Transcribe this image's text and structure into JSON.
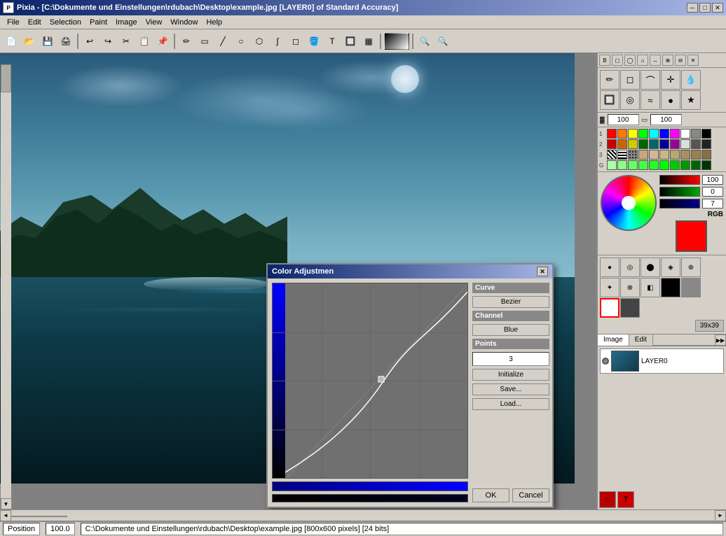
{
  "titlebar": {
    "title": "Pixia - [C:\\Dokumente und Einstellungen\\rdubach\\Desktop\\example.jpg [LAYER0] of Standard Accuracy]",
    "min_btn": "─",
    "max_btn": "□",
    "close_btn": "✕"
  },
  "menu": {
    "items": [
      "File",
      "Edit",
      "Selection",
      "Paint",
      "Image",
      "View",
      "Window",
      "Help"
    ]
  },
  "dialog": {
    "title": "Color Adjustmen",
    "close_btn": "✕",
    "curve_label": "Curve",
    "bezier_btn": "Bezier",
    "channel_label": "Channel",
    "blue_btn": "Blue",
    "points_label": "Points",
    "points_value": "3",
    "initialize_btn": "Initialize",
    "save_btn": "Save...",
    "load_btn": "Load...",
    "ok_btn": "OK",
    "cancel_btn": "Cancel"
  },
  "right_panel": {
    "opacity_value": "100",
    "size_value": "100",
    "rgb_label": "RGB",
    "color_r": "100",
    "color_g": "0",
    "color_b": "7",
    "layer_name": "LAYER0",
    "image_tab": "Image",
    "edit_tab": "Edit",
    "size_display": "39x39"
  },
  "status_bar": {
    "position": "Position",
    "zoom": "100.0",
    "file_info": "C:\\Dokumente und Einstellungen\\rdubach\\Desktop\\example.jpg [800x600 pixels] [24 bits]"
  },
  "palette": {
    "rows": [
      {
        "num": "1",
        "colors": [
          "#ff0000",
          "#ff8800",
          "#ffff00",
          "#88ff00",
          "#00ff00",
          "#00ff88",
          "#00ffff",
          "#0088ff",
          "#0000ff",
          "#8800ff",
          "#ff00ff",
          "#ff0088",
          "#ffffff"
        ]
      },
      {
        "num": "2",
        "colors": [
          "#cc0000",
          "#cc6600",
          "#cccc00",
          "#66cc00",
          "#00cc00",
          "#00cc66",
          "#00cccc",
          "#0066cc",
          "#0000cc",
          "#6600cc",
          "#cc00cc",
          "#cc0066",
          "#cccccc"
        ]
      },
      {
        "num": "3",
        "colors": [
          "#888888",
          "#996633",
          "#cc9966",
          "#ffcc99",
          "#ffcccc",
          "#ccffcc",
          "#ccccff",
          "#ffccff",
          "#996699",
          "#336699",
          "#669933",
          "#996600",
          "#000000"
        ]
      },
      {
        "num": "G",
        "colors": [
          "#aaffaa",
          "#88ff88",
          "#66ff66",
          "#44ff44",
          "#22ff22",
          "#00ff00",
          "#00dd00",
          "#00bb00",
          "#009900",
          "#007700",
          "#005500",
          "#003300",
          "#001100"
        ]
      }
    ]
  }
}
